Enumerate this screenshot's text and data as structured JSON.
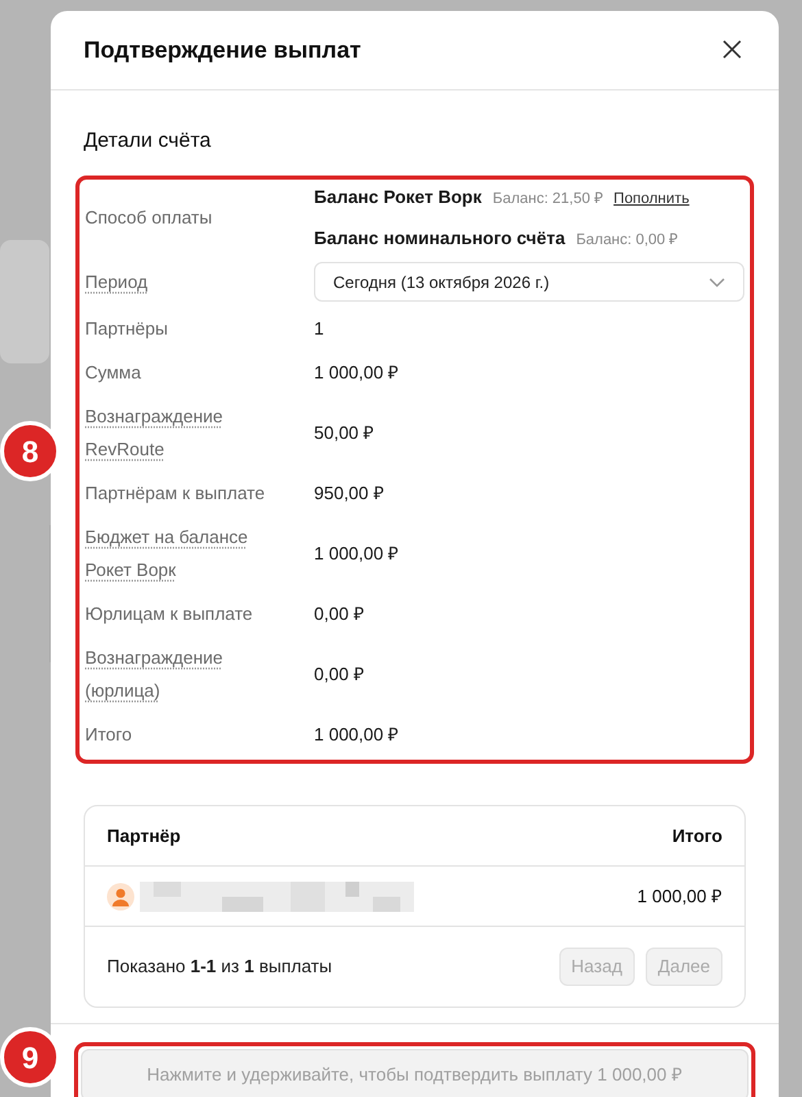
{
  "dialog": {
    "title": "Подтверждение выплат",
    "section_title": "Детали счёта",
    "details": [
      {
        "kind": "methods",
        "label": "Способ оплаты",
        "hint": false,
        "methods": [
          {
            "name": "Баланс Рокет Ворк",
            "balance": "Баланс: 21,50 ₽",
            "action": "Пополнить"
          },
          {
            "name": "Баланс номинального счёта",
            "balance": "Баланс: 0,00 ₽"
          }
        ]
      },
      {
        "kind": "select",
        "label": "Период",
        "hint": true,
        "value": "Сегодня (13 октября 2026 г.)"
      },
      {
        "kind": "text",
        "label": "Партнёры",
        "hint": false,
        "value": "1"
      },
      {
        "kind": "text",
        "label": "Сумма",
        "hint": false,
        "value": "1 000,00 ₽"
      },
      {
        "kind": "text",
        "label": "Вознаграждение RevRoute",
        "hint": true,
        "value": "50,00 ₽"
      },
      {
        "kind": "text",
        "label": "Партнёрам к выплате",
        "hint": false,
        "value": "950,00 ₽"
      },
      {
        "kind": "text",
        "label": "Бюджет на балансе Рокет Ворк",
        "hint": true,
        "value": "1 000,00 ₽"
      },
      {
        "kind": "text",
        "label": "Юрлицам к выплате",
        "hint": false,
        "value": "0,00 ₽"
      },
      {
        "kind": "text",
        "label": "Вознаграждение (юрлица)",
        "hint": true,
        "value": "0,00 ₽"
      },
      {
        "kind": "text",
        "label": "Итого",
        "hint": false,
        "value": "1 000,00 ₽"
      }
    ],
    "table": {
      "columns": [
        "Партнёр",
        "Итого"
      ],
      "rows": [
        {
          "total": "1 000,00 ₽"
        }
      ],
      "pagination": {
        "summary": "Показано **1-1** из **1** выплаты",
        "buttons": [
          {
            "label": "Назад",
            "disabled": true
          },
          {
            "label": "Далее",
            "disabled": true
          }
        ]
      }
    },
    "confirm_button": {
      "label": "Нажмите и удерживайте, чтобы подтвердить выплату 1 000,00 ₽",
      "disabled": true
    }
  },
  "annotations": [
    {
      "number": "8"
    },
    {
      "number": "9"
    }
  ]
}
